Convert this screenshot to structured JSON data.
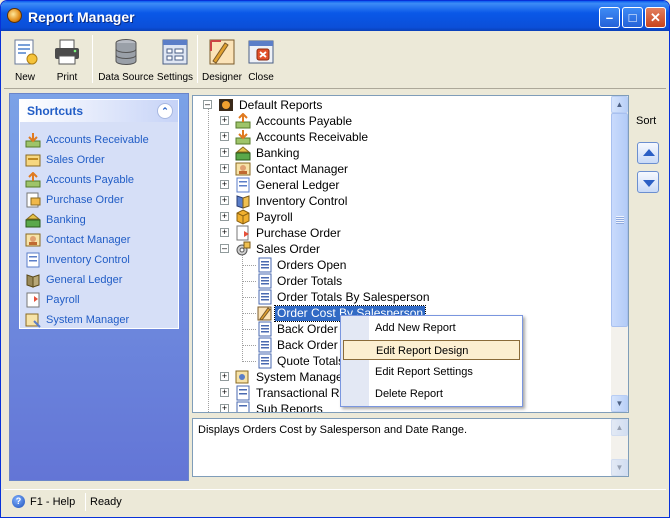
{
  "window": {
    "title": "Report Manager"
  },
  "toolbar": {
    "new_label": "New",
    "print_label": "Print",
    "datasource_label": "Data Source",
    "settings_label": "Settings",
    "designer_label": "Designer",
    "close_label": "Close"
  },
  "shortcuts": {
    "title": "Shortcuts",
    "items": [
      {
        "label": "Accounts Receivable",
        "icon": "accounts-receivable-icon"
      },
      {
        "label": "Sales Order",
        "icon": "sales-order-icon"
      },
      {
        "label": "Accounts Payable",
        "icon": "accounts-payable-icon"
      },
      {
        "label": "Purchase Order",
        "icon": "purchase-order-icon"
      },
      {
        "label": "Banking",
        "icon": "banking-icon"
      },
      {
        "label": "Contact Manager",
        "icon": "contact-manager-icon"
      },
      {
        "label": "Inventory Control",
        "icon": "inventory-control-icon"
      },
      {
        "label": "General Ledger",
        "icon": "general-ledger-icon"
      },
      {
        "label": "Payroll",
        "icon": "payroll-icon"
      },
      {
        "label": "System Manager",
        "icon": "system-manager-icon"
      }
    ]
  },
  "tree": {
    "root": "Default Reports",
    "modules": [
      "Accounts Payable",
      "Accounts Receivable",
      "Banking",
      "Contact Manager",
      "General Ledger",
      "Inventory Control",
      "Payroll",
      "Purchase Order",
      "Sales Order"
    ],
    "sales_order_reports": [
      "Orders Open",
      "Order Totals",
      "Order Totals By Salesperson",
      "Order Cost By Salesperson",
      "Back Order T",
      "Back Order D",
      "Quote Totals"
    ],
    "after_modules": [
      "System Manager",
      "Transactional Rep",
      "Sub Reports"
    ],
    "selected": "Order Cost By Salesperson"
  },
  "context_menu": {
    "items": [
      "Add New Report",
      "Edit Report Design",
      "Edit Report Settings",
      "Delete Report"
    ],
    "highlighted": "Edit Report Design"
  },
  "description": "Displays Orders Cost by Salesperson and Date Range.",
  "sort": {
    "label": "Sort"
  },
  "status": {
    "help": "F1 - Help",
    "state": "Ready"
  },
  "colors": {
    "title_bar": "#0a58e8",
    "selection": "#316ac5",
    "shortcut_text": "#215dc6",
    "panel": "#7ba2e7",
    "menu_hover": "#fcefd1"
  }
}
